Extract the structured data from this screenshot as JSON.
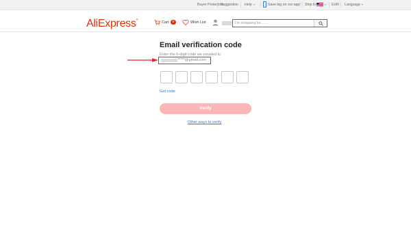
{
  "topbar": {
    "buyer_protection": "Buyer Protection",
    "suggestion": "Suggestion",
    "help": "Help",
    "app": "Save big on our app!",
    "ship_to": "Ship to",
    "currency": "EUR",
    "language": "Language"
  },
  "header": {
    "logo": "AliExpress",
    "cart_label": "Cart",
    "cart_count": "0",
    "wish_list": "Wish List",
    "search_placeholder": "I'm shopping for..."
  },
  "verification": {
    "title": "Email verification code",
    "instructions": "Enter the 6-digit code we emailed to",
    "email_suffix": "*****@gmail.com",
    "get_code": "Get code",
    "verify_button": "Verify",
    "other_ways": "Other ways to verify"
  },
  "colors": {
    "brand": "#e62e04",
    "link": "#2f7ad9",
    "verify_button_disabled": "#fcb5b9",
    "highlight_box": "#e4252c"
  }
}
